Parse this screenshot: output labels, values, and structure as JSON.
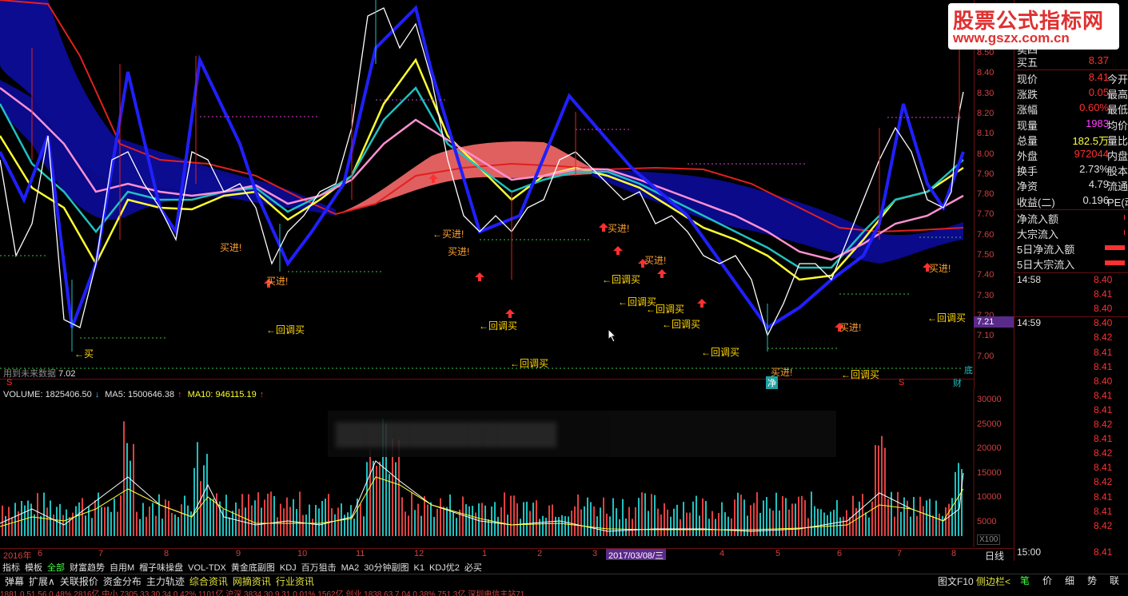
{
  "watermark": {
    "title": "股票公式指标网",
    "url": "www.gszx.com.cn"
  },
  "price_axis": [
    "8.50",
    "8.40",
    "8.30",
    "8.20",
    "8.10",
    "8.00",
    "7.90",
    "7.80",
    "7.70",
    "7.60",
    "7.50",
    "7.40",
    "7.30",
    "7.20",
    "7.10",
    "7.00"
  ],
  "current_price_tag": "7.21",
  "annotations": {
    "buy_in": "买进!",
    "buy_in_left": "←买进!",
    "pullback_buy": "←回调买",
    "buy": "←买",
    "pullback_buy_short": "回调买"
  },
  "future_note": "用到未来数据",
  "low_value": "7.02",
  "markers": {
    "s": "S",
    "jing": "净",
    "di": "底",
    "cai": "财"
  },
  "vol_legend": {
    "volume": "VOLUME: 1825406.50",
    "ma5": "MA5: 1500646.38",
    "ma10": "MA10: 946115.19"
  },
  "vol_axis": [
    "30000",
    "25000",
    "20000",
    "15000",
    "10000",
    "5000"
  ],
  "vol_scale": "X100",
  "dates": {
    "year_label": "2016年",
    "months": [
      "6",
      "7",
      "8",
      "9",
      "10",
      "11",
      "12",
      "1",
      "2",
      "3",
      "4",
      "5",
      "6",
      "7",
      "8"
    ],
    "highlight": "2017/03/08/三"
  },
  "line_label": "日线",
  "tabs": [
    "指标",
    "模板",
    "全部",
    "财富趋势",
    "自用M",
    "榴子味操盘",
    "VOL-TDX",
    "黄金底副图",
    "KDJ",
    "百万狙击",
    "MA2",
    "30分钟副图",
    "K1",
    "KDJ优2",
    "必买"
  ],
  "bottom_tabs": [
    "弹幕",
    "扩展∧",
    "关联报价",
    "资金分布",
    "主力轨迹",
    "综合资讯",
    "网摘资讯",
    "行业资讯"
  ],
  "bottom_right": {
    "f10": "图文F10",
    "sidebar": "侧边栏<"
  },
  "right_tabs": [
    "笔",
    "价",
    "细",
    "势",
    "联"
  ],
  "status_text": "1881.0  51.56  0.48%  2816亿  中小 7305.33  30.34  0.42%  1101亿  沪深 3834.30  9.31  0.01%  1562亿  创业 1838.63  7.04  0.38%  751.3亿   深圳电信主站71",
  "quote": {
    "sell5": {
      "label": "买五",
      "value": "8.37"
    },
    "sell_top": {
      "label": "卖四",
      "value": ""
    },
    "rows": [
      {
        "label": "现价",
        "value": "8.41",
        "side": "今开",
        "color": "#ff3030"
      },
      {
        "label": "涨跌",
        "value": "0.05",
        "side": "最高",
        "color": "#ff3030"
      },
      {
        "label": "涨幅",
        "value": "0.60%",
        "side": "最低",
        "color": "#ff3030"
      },
      {
        "label": "现量",
        "value": "1983",
        "side": "均价",
        "color": "#ff40ff"
      },
      {
        "label": "总量",
        "value": "182.5万",
        "side": "量比",
        "color": "#ffff40"
      },
      {
        "label": "外盘",
        "value": "972044",
        "side": "内盘",
        "color": "#ff3030"
      },
      {
        "label": "换手",
        "value": "2.73%",
        "side": "股本",
        "color": "#e0e0e0"
      },
      {
        "label": "净资",
        "value": "4.79",
        "side": "流通",
        "color": "#e0e0e0"
      },
      {
        "label": "收益(二)",
        "value": "0.196",
        "side": "PE(动)",
        "color": "#e0e0e0"
      }
    ],
    "flows": [
      {
        "label": "净流入额",
        "bar": 0.05
      },
      {
        "label": "大宗流入",
        "bar": 0.05
      },
      {
        "label": "5日净流入额",
        "bar": 0.85
      },
      {
        "label": "5日大宗流入",
        "bar": 0.85
      }
    ]
  },
  "ticks": [
    {
      "time": "14:58",
      "prices": [
        "8.40",
        "8.41",
        "8.40"
      ]
    },
    {
      "time": "14:59",
      "prices": [
        "8.40",
        "8.42",
        "8.41",
        "8.41",
        "8.40",
        "8.41",
        "8.41",
        "8.42",
        "8.41",
        "8.42",
        "8.41",
        "8.42",
        "8.41",
        "8.41",
        "8.42"
      ]
    },
    {
      "time": "15:00",
      "prices": [
        "8.41"
      ]
    }
  ]
}
